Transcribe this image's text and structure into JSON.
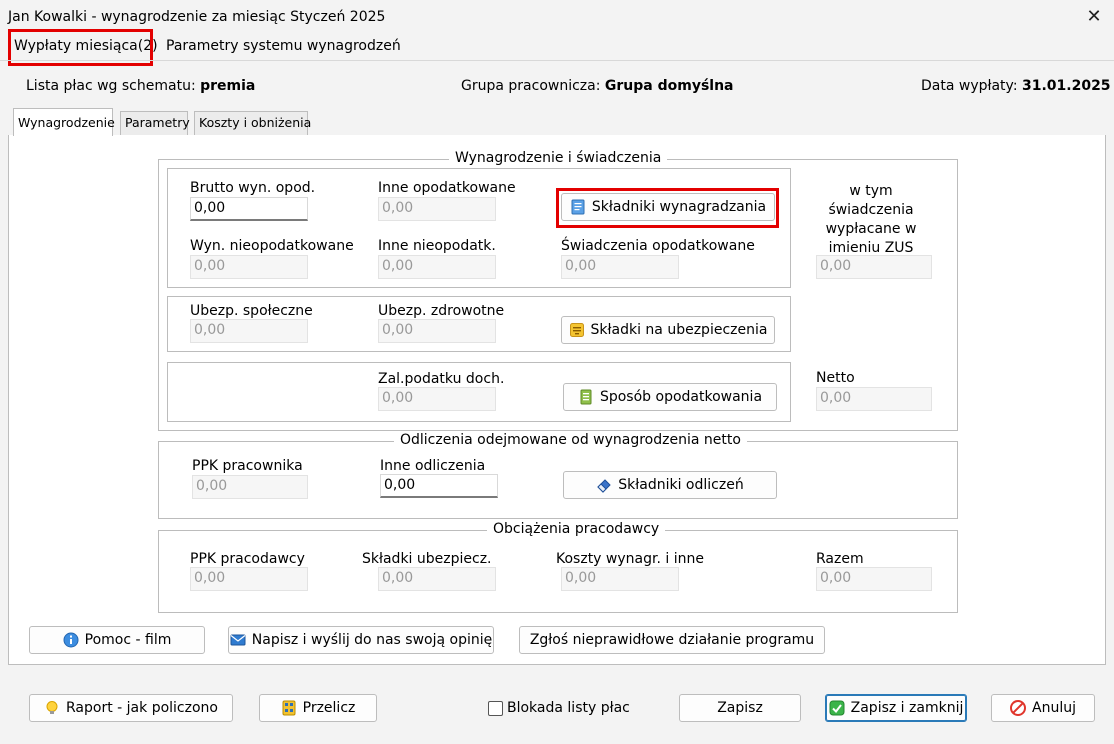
{
  "window": {
    "title": "Jan Kowalki - wynagrodzenie za miesiąc Styczeń 2025",
    "close_glyph": "✕"
  },
  "menu": {
    "items": [
      {
        "label": "Wypłaty miesiąca(2)",
        "highlighted": true
      },
      {
        "label": "Parametry systemu wynagrodzeń",
        "highlighted": false
      }
    ]
  },
  "info": {
    "schema_label": "Lista płac wg schematu:",
    "schema_value": "premia",
    "group_label": "Grupa pracownicza:",
    "group_value": "Grupa domyślna",
    "date_label": "Data wypłaty:",
    "date_value": "31.01.2025"
  },
  "tabs": [
    {
      "label": "Wynagrodzenie",
      "active": true
    },
    {
      "label": "Parametry",
      "active": false
    },
    {
      "label": "Koszty i obniżenia",
      "active": false
    }
  ],
  "wynagrodzenie": {
    "title": "Wynagrodzenie i świadczenia",
    "brutto_label": "Brutto wyn. opod.",
    "brutto_value": "0,00",
    "inne_opodatkowane_label": "Inne opodatkowane",
    "inne_opodatkowane_value": "0,00",
    "skladniki_button": "Składniki wynagradzania",
    "wtym_label": "w tym świadczenia wypłacane w imieniu ZUS",
    "wtym_value": "0,00",
    "wyn_nieopodatkowane_label": "Wyn. nieopodatkowane",
    "wyn_nieopodatkowane_value": "0,00",
    "inne_nieopodatk_label": "Inne nieopodatk.",
    "inne_nieopodatk_value": "0,00",
    "swiadczenia_opodatkowane_label": "Świadczenia opodatkowane",
    "swiadczenia_opodatkowane_value": "0,00",
    "ubezp_spoleczne_label": "Ubezp. społeczne",
    "ubezp_spoleczne_value": "0,00",
    "ubezp_zdrowotne_label": "Ubezp. zdrowotne",
    "ubezp_zdrowotne_value": "0,00",
    "skladki_button": "Składki na ubezpieczenia",
    "zal_podatku_label": "Zal.podatku doch.",
    "zal_podatku_value": "0,00",
    "sposob_button": "Sposób opodatkowania",
    "netto_label": "Netto",
    "netto_value": "0,00"
  },
  "odliczenia": {
    "title": "Odliczenia odejmowane od wynagrodzenia netto",
    "ppk_pracownika_label": "PPK pracownika",
    "ppk_pracownika_value": "0,00",
    "inne_odliczenia_label": "Inne odliczenia",
    "inne_odliczenia_value": "0,00",
    "skladniki_odliczen_button": "Składniki odliczeń"
  },
  "obciazenia": {
    "title": "Obciążenia pracodawcy",
    "ppk_pracodawcy_label": "PPK pracodawcy",
    "ppk_pracodawcy_value": "0,00",
    "skladki_ubezpiecz_label": "Składki ubezpiecz.",
    "skladki_ubezpiecz_value": "0,00",
    "koszty_label": "Koszty wynagr. i inne",
    "koszty_value": "0,00",
    "razem_label": "Razem",
    "razem_value": "0,00"
  },
  "help": {
    "pomoc_button": "Pomoc - film",
    "napisz_button": "Napisz i wyślij do nas swoją opinię",
    "zglos_button": "Zgłoś nieprawidłowe działanie programu"
  },
  "footer": {
    "raport_button": "Raport - jak policzono",
    "przelicz_button": "Przelicz",
    "blokada_label": "Blokada listy płac",
    "blokada_checked": false,
    "zapisz_button": "Zapisz",
    "zapisz_zamknij_button": "Zapisz i zamknij",
    "anuluj_button": "Anuluj"
  },
  "colors": {
    "highlight_red": "#e30000",
    "primary_border": "#2a7ab8"
  }
}
